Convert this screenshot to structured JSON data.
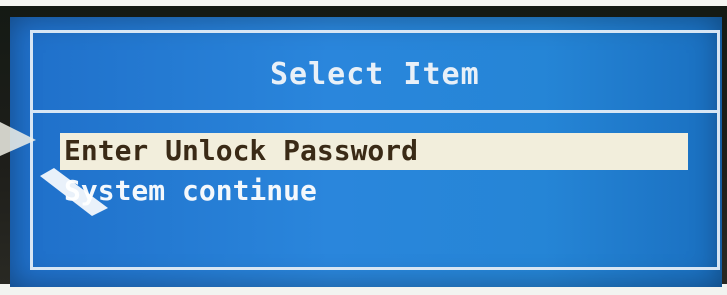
{
  "dialog": {
    "title": "Select Item",
    "items": [
      {
        "label": "Enter Unlock Password",
        "selected": true
      },
      {
        "label": "System continue",
        "selected": false
      }
    ]
  },
  "colors": {
    "screen_blue": "#2585d6",
    "frame_line": "#d8e6f4",
    "highlight_bg": "#f2eedc",
    "highlight_text": "#3a2a16",
    "menu_text": "#f4f8fc"
  },
  "icons": [
    "arrow-pointer-icon"
  ]
}
